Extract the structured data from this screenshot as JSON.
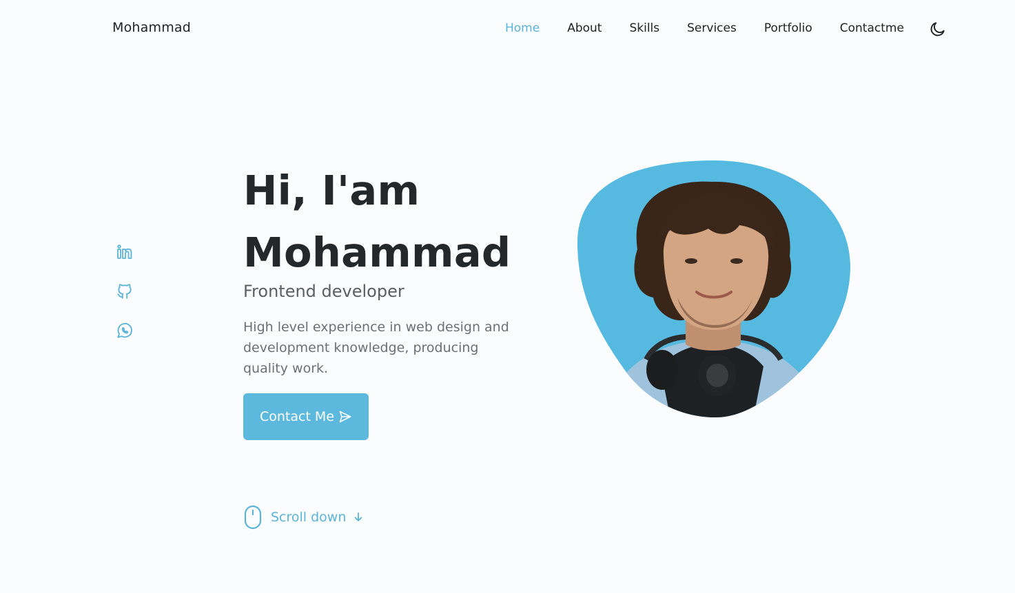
{
  "header": {
    "logo": "Mohammad",
    "nav": [
      {
        "label": "Home",
        "active": true
      },
      {
        "label": "About",
        "active": false
      },
      {
        "label": "Skills",
        "active": false
      },
      {
        "label": "Services",
        "active": false
      },
      {
        "label": "Portfolio",
        "active": false
      },
      {
        "label": "Contactme",
        "active": false
      }
    ],
    "theme_icon": "moon-icon"
  },
  "social": [
    {
      "icon": "linkedin-icon"
    },
    {
      "icon": "github-icon"
    },
    {
      "icon": "whatsapp-icon"
    }
  ],
  "hero": {
    "title_line1": "Hi, I'am",
    "title_line2": "Mohammad",
    "subtitle": "Frontend developer",
    "description": "High level experience in web design and development knowledge, producing quality work.",
    "button_label": "Contact Me",
    "button_icon": "send-icon",
    "scroll_label": "Scroll down",
    "scroll_icons": [
      "mouse-icon",
      "arrow-down-icon"
    ]
  },
  "colors": {
    "accent": "#5cb8dc",
    "background": "#fbfcfe",
    "title": "#25282a",
    "text": "#6c7073"
  }
}
